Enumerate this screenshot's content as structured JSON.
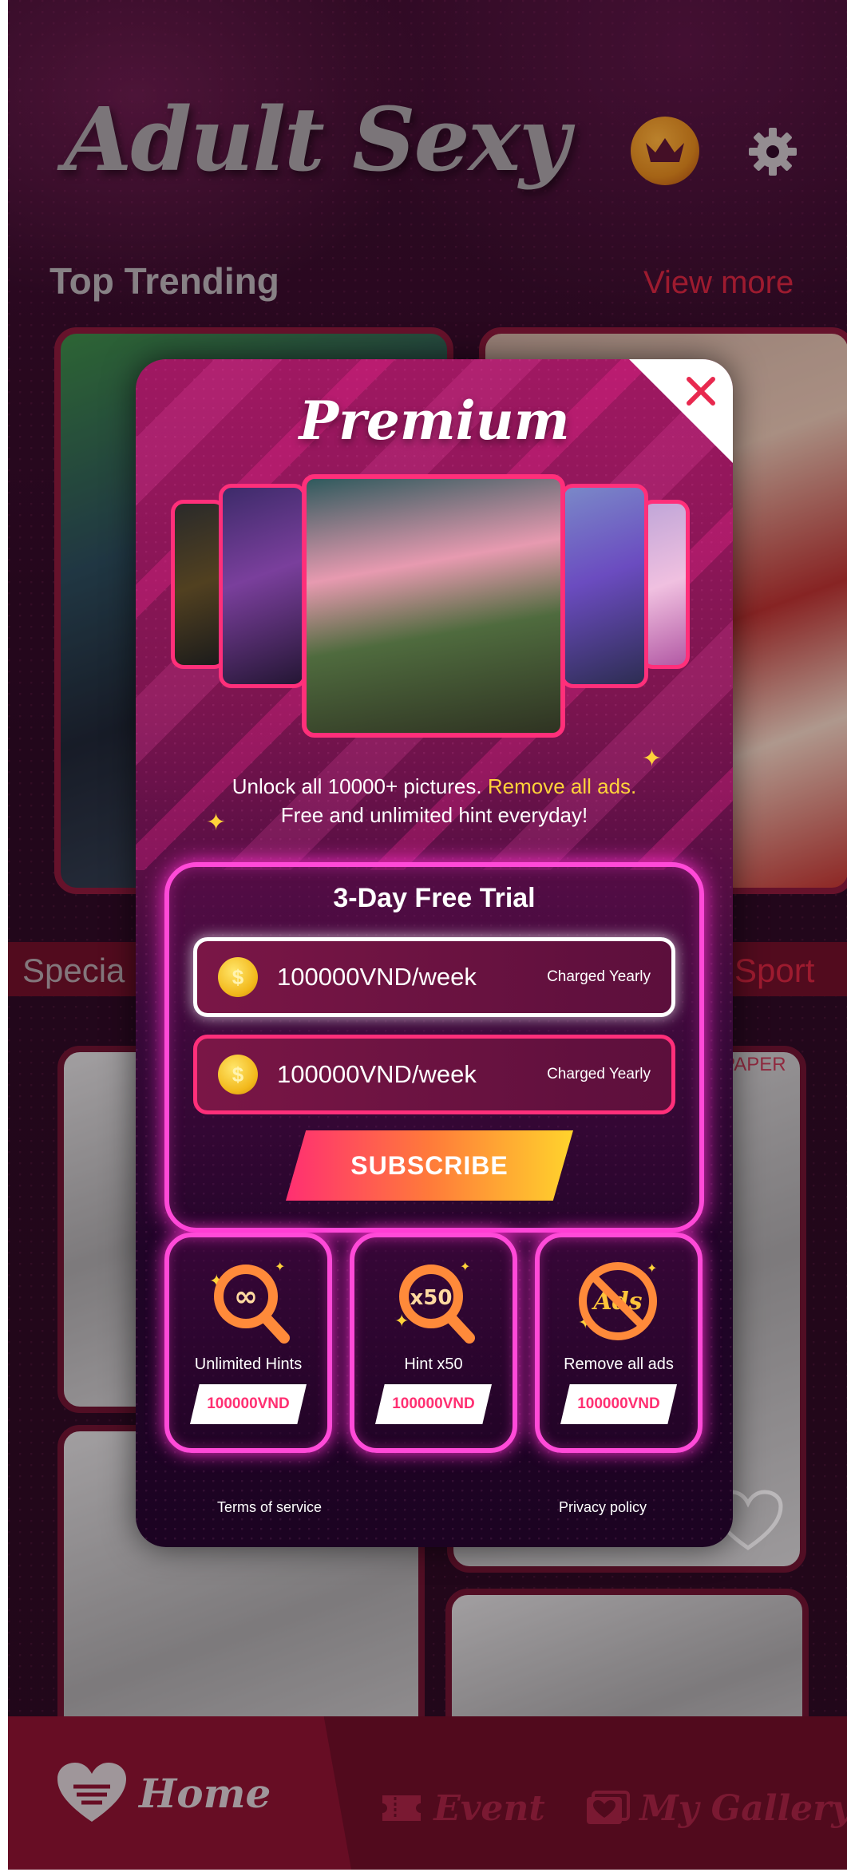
{
  "header": {
    "title": "Adult Sexy",
    "crown_icon": "crown-icon",
    "settings_icon": "gear-icon"
  },
  "trending": {
    "title": "Top Trending",
    "view_more": "View more"
  },
  "categories": {
    "left": "Specia",
    "right": "Sport"
  },
  "grid": {
    "tag": "PAPER"
  },
  "bottom_nav": {
    "home": "Home",
    "event": "Event",
    "gallery": "My Gallery"
  },
  "modal": {
    "title": "Premium",
    "desc_line1_prefix": "Unlock all 10000+ pictures. ",
    "desc_line1_highlight": "Remove all ads.",
    "desc_line2": "Free and unlimited hint everyday!",
    "trial": {
      "title": "3-Day Free Trial",
      "plans": [
        {
          "coin": "$",
          "price": "100000VND/week",
          "note": "Charged Yearly",
          "selected": true
        },
        {
          "coin": "$",
          "price": "100000VND/week",
          "note": "Charged Yearly",
          "selected": false
        }
      ],
      "subscribe_label": "SUBSCRIBE"
    },
    "offers": [
      {
        "label": "Unlimited Hints",
        "price": "100000VND",
        "icon": "infinity-magnifier-icon",
        "icon_text": "∞"
      },
      {
        "label": "Hint x50",
        "price": "100000VND",
        "icon": "x50-magnifier-icon",
        "icon_text": "x50"
      },
      {
        "label": "Remove all ads",
        "price": "100000VND",
        "icon": "no-ads-icon",
        "icon_text": "Ads"
      }
    ],
    "terms": "Terms of service",
    "privacy": "Privacy policy"
  },
  "colors": {
    "accent": "#ff2f72",
    "highlight": "#ffd23a",
    "neon": "#ff4ad8",
    "background": "#2c0a23"
  }
}
